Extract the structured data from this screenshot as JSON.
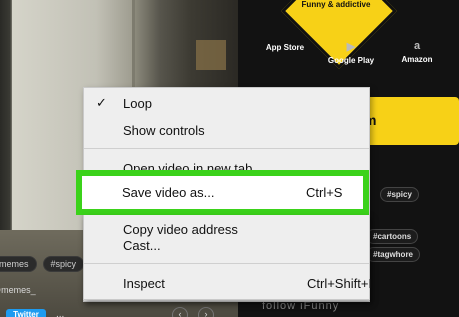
{
  "background_video": {
    "tags": [
      "#memes",
      "#spicy"
    ],
    "username": "@memes_",
    "twitter_label": "Twitter",
    "more_label": "...",
    "prev_label": "‹",
    "next_label": "›"
  },
  "sidebar": {
    "brand_text": "Funny & addictive",
    "stores": [
      {
        "icon": "apple-icon",
        "glyph": "",
        "label": "App Store"
      },
      {
        "icon": "google-play-icon",
        "glyph": "▶",
        "label": "Google Play"
      },
      {
        "icon": "amazon-icon",
        "glyph": "a",
        "label": "Amazon"
      }
    ],
    "yellow_button_label": "m",
    "tags": [
      "#spicy",
      "#cartoons",
      "#tagwhore"
    ],
    "follow_label": "follow iFunny"
  },
  "context_menu": {
    "items": [
      {
        "check": "✓",
        "label": "Loop",
        "shortcut": ""
      },
      {
        "check": "",
        "label": "Show controls",
        "shortcut": ""
      },
      {
        "check": "",
        "label": "Open video in new tab",
        "shortcut": ""
      },
      {
        "check": "",
        "label": "Save video as...",
        "shortcut": "Ctrl+S"
      },
      {
        "check": "",
        "label": "Copy video address",
        "shortcut": ""
      },
      {
        "check": "",
        "label": "Cast...",
        "shortcut": ""
      },
      {
        "check": "",
        "label": "Inspect",
        "shortcut": "Ctrl+Shift+I"
      }
    ]
  },
  "colors": {
    "highlight": "#3bd21a",
    "brand_yellow": "#f7d117",
    "menu_bg": "#eeeeee"
  }
}
